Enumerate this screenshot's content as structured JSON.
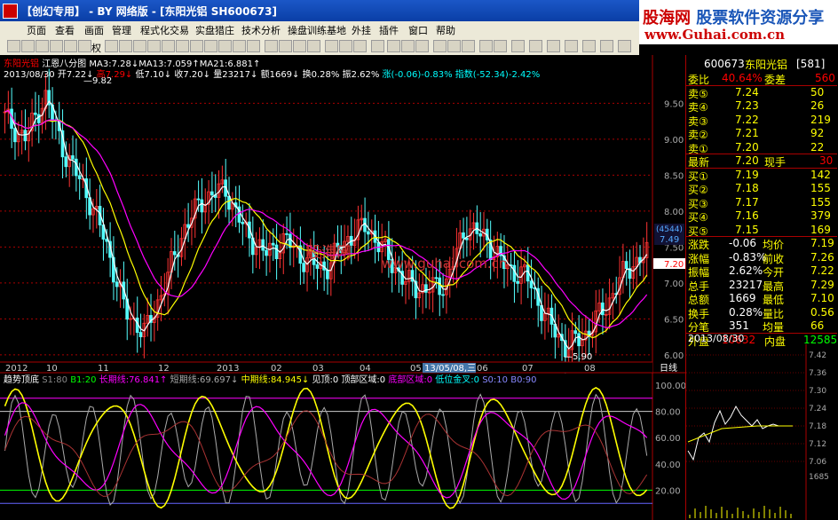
{
  "window": {
    "title": "【创幻专用】 - BY 网络版 - [东阳光铝 SH600673]"
  },
  "watermark": {
    "text_a": "股海网",
    "text_b": "股票软件资源分享",
    "url": "www.Guhai.com.cn"
  },
  "menu": [
    "页面",
    "查看",
    "画面",
    "管理",
    "程式化交易",
    "实盘猎庄",
    "技术分析",
    "操盘训练基地",
    "外挂",
    "插件",
    "窗口",
    "帮助"
  ],
  "toolbar": {
    "speed_label": "权"
  },
  "chart_header": {
    "stock_name": "东阳光铝",
    "indicator_name": "江恩八分图",
    "ma_info": "MA3:7.28↓MA13:7.059↑MA21:6.881↑",
    "date": "2013/08/30",
    "open": "开7.22↓",
    "high": "高7.29↓",
    "low": "低7.10↓",
    "close": "收7.20↓",
    "volume": "量23217↓",
    "amount": "额1669↓",
    "turnover": "换0.28%",
    "amplitude": "振2.62%",
    "change": "涨(-0.06)-0.83%",
    "index": "指数(-52.34)-2.42%"
  },
  "price_axis": [
    "9.50",
    "9.00",
    "8.50",
    "8.00",
    "7.50",
    "7.00",
    "6.50",
    "6.00"
  ],
  "price_marks": {
    "high_mark": "9.82",
    "low_mark": "5.90",
    "current": "7.20",
    "counter": "(4544)",
    "counter_val": "7.49"
  },
  "time_axis": [
    "2012",
    "10",
    "11",
    "12",
    "2013",
    "02",
    "03",
    "04",
    "05",
    "13/05/08,三",
    "06",
    "07",
    "08"
  ],
  "daily_label": "日线",
  "overlay_watermark": {
    "cn": "股海网",
    "url": "www.guhai.com.cn"
  },
  "indicator": {
    "name": "趋势顶底",
    "s1": "S1:80",
    "b1": "B1:20",
    "long": "长期线:76.841↑",
    "short": "短期线:69.697↓",
    "mid": "中期线:84.945↓",
    "top": "见顶:0",
    "top_zone": "顶部区域:0",
    "bottom_zone": "底部区域:0",
    "low_cross": "低位金叉:0",
    "s0": "S0:10",
    "b0": "B0:90",
    "axis": [
      "100.00",
      "80.00",
      "60.00",
      "40.00",
      "20.00"
    ]
  },
  "quote": {
    "code": "600673",
    "name": "东阳光铝",
    "badge": "[581]",
    "weibi_label": "委比",
    "weibi": "40.64%",
    "weicha_label": "委差",
    "weicha": "560",
    "asks": [
      {
        "label": "卖⑤",
        "price": "7.24",
        "vol": "50"
      },
      {
        "label": "卖④",
        "price": "7.23",
        "vol": "26"
      },
      {
        "label": "卖③",
        "price": "7.22",
        "vol": "219"
      },
      {
        "label": "卖②",
        "price": "7.21",
        "vol": "92"
      },
      {
        "label": "卖①",
        "price": "7.20",
        "vol": "22"
      }
    ],
    "latest_label": "最新",
    "latest": "7.20",
    "xianshou_label": "现手",
    "xianshou": "30",
    "bids": [
      {
        "label": "买①",
        "price": "7.19",
        "vol": "142"
      },
      {
        "label": "买②",
        "price": "7.18",
        "vol": "155"
      },
      {
        "label": "买③",
        "price": "7.17",
        "vol": "155"
      },
      {
        "label": "买④",
        "price": "7.16",
        "vol": "379"
      },
      {
        "label": "买⑤",
        "price": "7.15",
        "vol": "169"
      }
    ],
    "stats": [
      {
        "l1": "涨跌",
        "v1": "-0.06",
        "l2": "均价",
        "v2": "7.19"
      },
      {
        "l1": "涨幅",
        "v1": "-0.83%",
        "l2": "前收",
        "v2": "7.26"
      },
      {
        "l1": "振幅",
        "v1": "2.62%",
        "l2": "今开",
        "v2": "7.22"
      },
      {
        "l1": "总手",
        "v1": "23217",
        "l2": "最高",
        "v2": "7.29"
      },
      {
        "l1": "总额",
        "v1": "1669",
        "l2": "最低",
        "v2": "7.10"
      },
      {
        "l1": "换手",
        "v1": "0.28%",
        "l2": "量比",
        "v2": "0.56"
      },
      {
        "l1": "分笔",
        "v1": "351",
        "l2": "均量",
        "v2": "66"
      }
    ],
    "outer_label": "外盘",
    "outer": "10632",
    "inner_label": "内盘",
    "inner": "12585",
    "mini_date": "2013/08/30",
    "mini_axis": [
      "7.42",
      "7.36",
      "7.30",
      "7.24",
      "7.18",
      "7.12",
      "7.06"
    ],
    "mini_vol": "1685"
  }
}
